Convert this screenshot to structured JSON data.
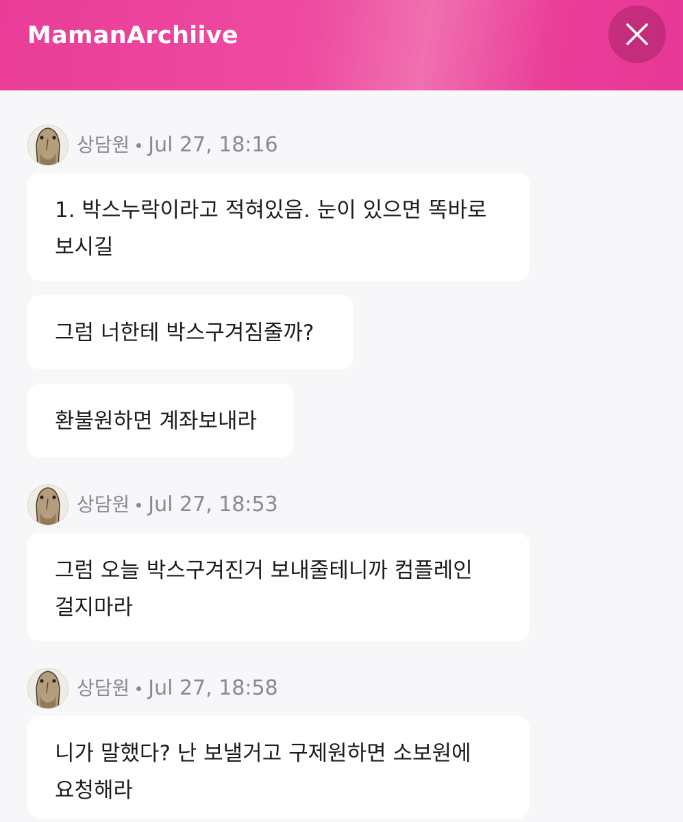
{
  "header": {
    "title": "MamanArchiive",
    "close_icon": "close-icon",
    "gradient_colors": [
      "#ea3d98",
      "#f070b0",
      "#e83795"
    ]
  },
  "thread": {
    "groups": [
      {
        "sender": "상담원",
        "time": "Jul 27, 18:16",
        "avatar_icon": "agent-avatar",
        "messages": [
          "1. 박스누락이라고 적혀있음. 눈이 있으면 똑바로\n보시길",
          "그럼 너한테 박스구겨짐줄까?",
          "환불원하면 계좌보내라"
        ]
      },
      {
        "sender": "상담원",
        "time": "Jul 27, 18:53",
        "avatar_icon": "agent-avatar",
        "messages": [
          "그럼 오늘 박스구겨진거 보내줄테니까 컴플레인\n걸지마라"
        ]
      },
      {
        "sender": "상담원",
        "time": "Jul 27, 18:58",
        "avatar_icon": "agent-avatar",
        "messages": [
          "니가 말했다? 난 보낼거고 구제원하면 소보원에\n요청해라"
        ]
      }
    ]
  }
}
